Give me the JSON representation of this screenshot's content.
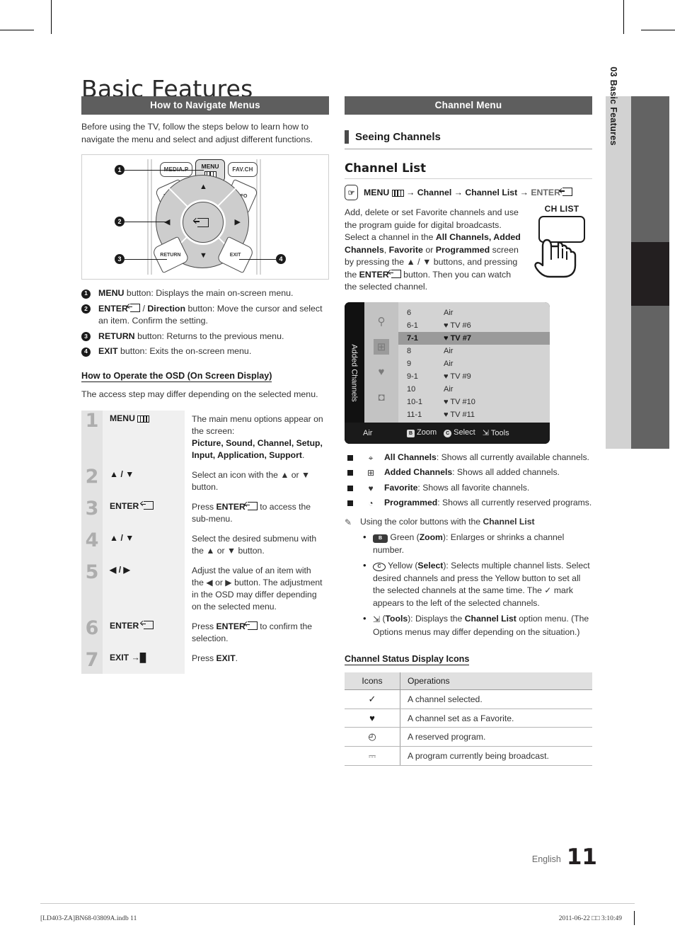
{
  "document": {
    "title": "Basic Features",
    "page_number": "11",
    "language_label": "English",
    "side_tab": "03  Basic Features",
    "footer_left": "[LD403-ZA]BN68-03809A.indb   11",
    "footer_right": "2011-06-22   □□ 3:10:49"
  },
  "left_column": {
    "section_bar": "How to Navigate Menus",
    "intro": "Before using the TV, follow the steps below to learn how to navigate the menu and select and adjust different functions.",
    "remote": {
      "buttons": {
        "media_p": "MEDIA.P",
        "menu": "MENU",
        "fav_ch": "FAV.CH",
        "tools": "TOOLS",
        "info": "INFO",
        "return": "RETURN",
        "exit": "EXIT"
      },
      "callouts": [
        "1",
        "2",
        "3",
        "4"
      ]
    },
    "legend": [
      {
        "num": "1",
        "html": "<b>MENU</b> button: Displays the main on-screen menu."
      },
      {
        "num": "2",
        "html": "<b>ENTER</b><span class=\"inline-enter\"></span> / <b>Direction</b> button: Move the cursor and select an item. Confirm the setting."
      },
      {
        "num": "3",
        "html": "<b>RETURN</b> button: Returns to the previous menu."
      },
      {
        "num": "4",
        "html": "<b>EXIT</b> button: Exits the on-screen menu."
      }
    ],
    "osd_heading": "How to Operate the OSD (On Screen Display)",
    "osd_intro": "The access step may differ depending on the selected menu.",
    "steps": [
      {
        "num": "1",
        "key_html": "MENU <span class=\"inline-menu\"><i></i><i></i><i></i></span>",
        "desc_html": "The main menu options appear on the screen:<br><b>Picture, Sound, Channel, Setup, Input, Application, Support</b>."
      },
      {
        "num": "2",
        "key_html": "▲ / ▼",
        "desc_html": "Select an icon with the ▲ or ▼ button."
      },
      {
        "num": "3",
        "key_html": "ENTER <span class=\"inline-enter\"></span>",
        "desc_html": "Press <b>ENTER</b><span class=\"inline-enter\"></span> to access the sub-menu."
      },
      {
        "num": "4",
        "key_html": "▲ / ▼",
        "desc_html": "Select the desired submenu with the ▲ or ▼ button."
      },
      {
        "num": "5",
        "key_html": "◀ / ▶",
        "desc_html": "Adjust the value of an item with the ◀ or ▶ button. The adjustment in the OSD may differ depending on the selected menu."
      },
      {
        "num": "6",
        "key_html": "ENTER <span class=\"inline-enter\"></span>",
        "desc_html": "Press <b>ENTER</b><span class=\"inline-enter\"></span> to confirm the selection."
      },
      {
        "num": "7",
        "key_html": "EXIT →█",
        "desc_html": "Press <b>EXIT</b>."
      }
    ]
  },
  "right_column": {
    "section_bar": "Channel Menu",
    "seeing_channels": "Seeing Channels",
    "channel_list_heading": "Channel List",
    "menu_path_html": "MENU <span class=\"inline-menu\"><i></i><i></i><i></i></span> → Channel → Channel List → <span class=\"gray\">ENTER</span><span class=\"inline-enter\"></span>",
    "description_html": "Add, delete or set Favorite channels and use the program guide for digital broadcasts.<br>Select a channel in the <b>All Channels, Added Channels</b>, <b>Favorite</b> or <b>Programmed</b> screen by pressing the ▲ / ▼ buttons, and pressing the <b>ENTER</b><span class=\"inline-enter\"></span> button. Then you can watch the selected channel.",
    "ch_list_key": "CH LIST",
    "osd": {
      "vertical_tab": "Added Channels",
      "side_icons": [
        "all-channels-icon",
        "added-channels-icon",
        "favorite-icon",
        "programmed-icon"
      ],
      "rows": [
        {
          "number": "6",
          "name": "Air",
          "fav": false,
          "highlight": false
        },
        {
          "number": "6-1",
          "name": "TV #6",
          "fav": true,
          "highlight": false
        },
        {
          "number": "7-1",
          "name": "TV #7",
          "fav": true,
          "highlight": true
        },
        {
          "number": "8",
          "name": "Air",
          "fav": false,
          "highlight": false
        },
        {
          "number": "9",
          "name": "Air",
          "fav": false,
          "highlight": false
        },
        {
          "number": "9-1",
          "name": "TV #9",
          "fav": true,
          "highlight": false
        },
        {
          "number": "10",
          "name": "Air",
          "fav": false,
          "highlight": false
        },
        {
          "number": "10-1",
          "name": "TV #10",
          "fav": true,
          "highlight": false
        },
        {
          "number": "11-1",
          "name": "TV #11",
          "fav": true,
          "highlight": false
        }
      ],
      "bottom_bar": {
        "air": "Air",
        "zoom": "Zoom",
        "select": "Select",
        "tools": "Tools",
        "zoom_key": "B",
        "select_key": "C"
      }
    },
    "list_types": [
      {
        "icon": "all-channels-icon",
        "glyph": "⌖",
        "html": "<b>All Channels</b>: Shows all currently available channels."
      },
      {
        "icon": "added-channels-icon",
        "glyph": "⊞",
        "html": "<b>Added Channels</b>: Shows all added channels."
      },
      {
        "icon": "favorite-icon",
        "glyph": "♥",
        "html": "<b>Favorite</b>: Shows all favorite channels."
      },
      {
        "icon": "programmed-icon",
        "glyph": "◔",
        "html": "<b>Programmed</b>: Shows all currently reserved programs."
      }
    ],
    "color_note_html": "Using the color buttons with the <b>Channel List</b>",
    "color_buttons": [
      {
        "key": "B",
        "key_style": "fill",
        "html": "Green (<b>Zoom</b>): Enlarges or shrinks a channel number."
      },
      {
        "key": "C",
        "key_style": "round",
        "html": "Yellow (<b>Select</b>): Selects multiple channel lists. Select desired channels and press the Yellow button to set all the selected channels at the same time. The ✓ mark appears to the left of the selected channels."
      },
      {
        "key": "tools",
        "key_style": "icon",
        "html": "(<b>Tools</b>): Displays the <b>Channel List</b> option menu. (The Options menus may differ depending on the situation.)"
      }
    ],
    "status_icons_heading": "Channel Status Display Icons",
    "status_table": {
      "headers": [
        "Icons",
        "Operations"
      ],
      "rows": [
        {
          "icon": "✓",
          "icon_name": "check-icon",
          "text": "A channel selected."
        },
        {
          "icon": "♥",
          "icon_name": "heart-icon",
          "text": "A channel set as a Favorite."
        },
        {
          "icon": "◴",
          "icon_name": "clock-icon",
          "text": "A reserved program."
        },
        {
          "icon": "⎓",
          "icon_name": "tv-icon",
          "text": "A program currently being broadcast."
        }
      ]
    }
  },
  "colors": {
    "section_bar": "#5e5e5e",
    "side_tab": "#d2d2d2",
    "side_bar_gray": "#636363",
    "side_bar_black": "#231f20",
    "step_num_bg": "#e3e3e3",
    "step_key_bg": "#f0f0f0"
  }
}
